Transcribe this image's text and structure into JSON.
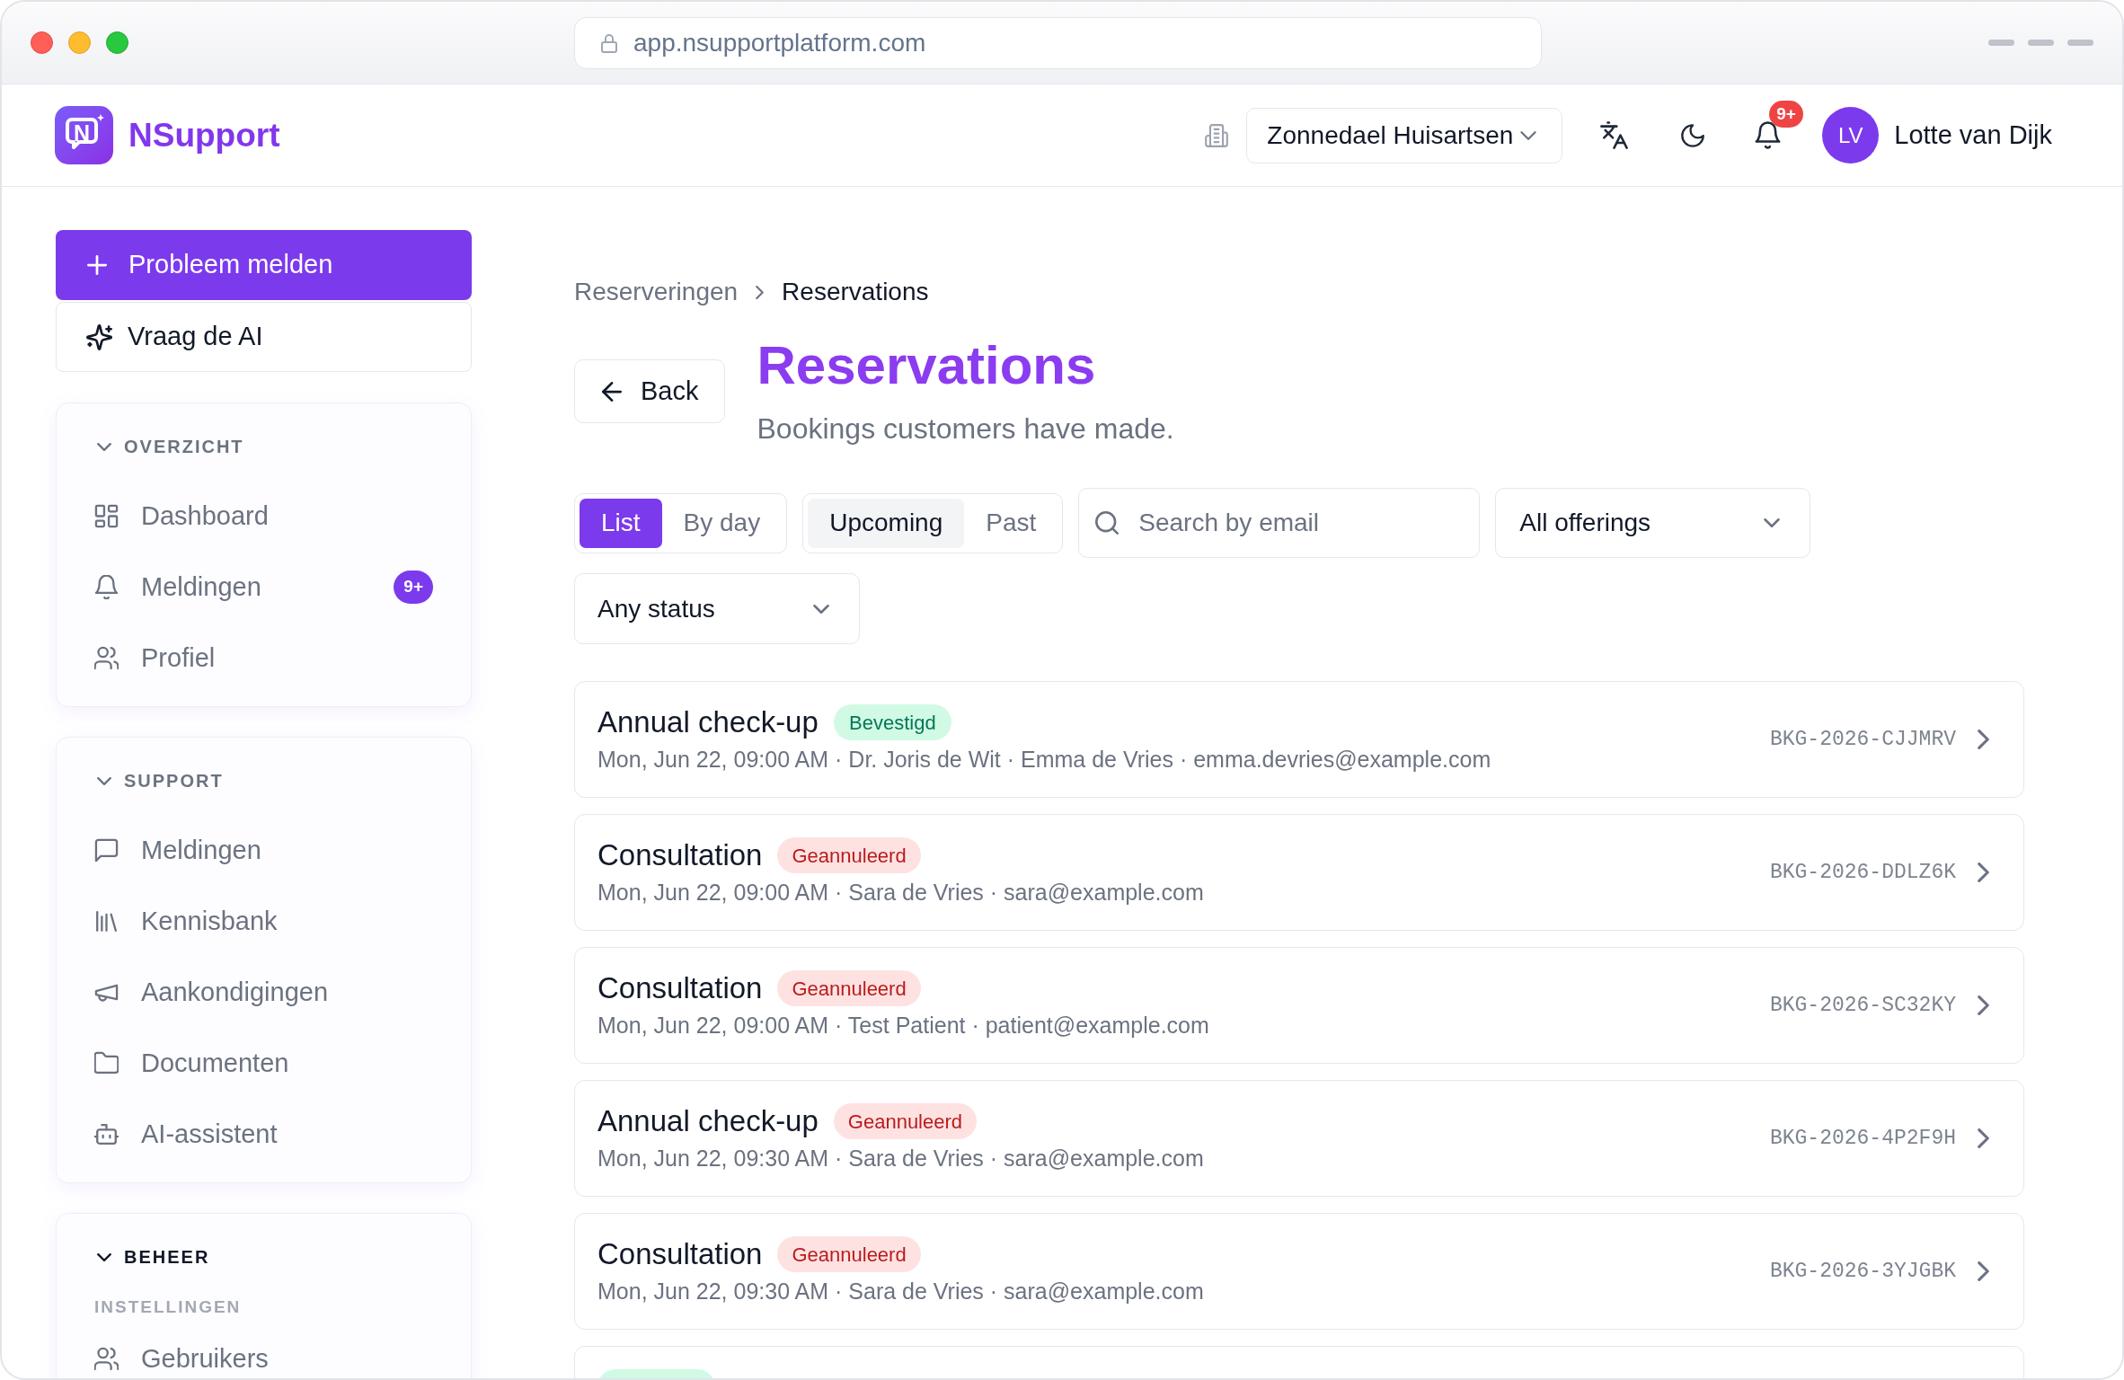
{
  "browser": {
    "url": "app.nsupportplatform.com"
  },
  "header": {
    "brand": {
      "logo_letter": "N",
      "name": "NSupport"
    },
    "organization_select": {
      "value": "Zonnedael Huisartsen"
    },
    "notifications": {
      "badge": "9+"
    },
    "user": {
      "initials": "LV",
      "name": "Lotte van Dijk"
    }
  },
  "sidebar": {
    "actions": [
      {
        "label": "Probleem melden",
        "kind": "primary"
      },
      {
        "label": "Vraag de AI",
        "kind": "secondary"
      }
    ],
    "groups": [
      {
        "title": "OVERZICHT",
        "expanded": true,
        "active": false,
        "items": [
          {
            "kind": "link",
            "label": "Dashboard"
          },
          {
            "kind": "link",
            "label": "Meldingen",
            "badge": "9+"
          },
          {
            "kind": "link",
            "label": "Profiel"
          }
        ]
      },
      {
        "title": "SUPPORT",
        "expanded": true,
        "active": false,
        "items": [
          {
            "kind": "link",
            "label": "Meldingen"
          },
          {
            "kind": "link",
            "label": "Kennisbank"
          },
          {
            "kind": "link",
            "label": "Aankondigingen"
          },
          {
            "kind": "link",
            "label": "Documenten"
          },
          {
            "kind": "link",
            "label": "AI-assistent"
          }
        ]
      },
      {
        "title": "BEHEER",
        "expanded": true,
        "active": true,
        "items": [
          {
            "kind": "heading",
            "label": "INSTELLINGEN"
          },
          {
            "kind": "link",
            "label": "Gebruikers"
          }
        ]
      }
    ]
  },
  "page": {
    "breadcrumb": [
      {
        "label": "Reserveringen",
        "current": false
      },
      {
        "label": "Reservations",
        "current": true
      }
    ],
    "back_button": "Back",
    "title": "Reservations",
    "subtitle": "Bookings customers have made.",
    "filters": {
      "view_toggle": [
        {
          "label": "List",
          "selected": true
        },
        {
          "label": "By day",
          "selected": false
        }
      ],
      "time_toggle": [
        {
          "label": "Upcoming",
          "selected": true
        },
        {
          "label": "Past",
          "selected": false
        }
      ],
      "search": {
        "placeholder": "Search by email"
      },
      "offering_select": {
        "value": "All offerings"
      },
      "status_select": {
        "value": "Any status"
      }
    },
    "reservations": [
      {
        "title": "Annual check-up",
        "status": {
          "label": "Bevestigd",
          "kind": "confirmed"
        },
        "details": "Mon, Jun 22, 09:00 AM · Dr. Joris de Wit · Emma de Vries · emma.devries@example.com",
        "code": "BKG-2026-CJJMRV"
      },
      {
        "title": "Consultation",
        "status": {
          "label": "Geannuleerd",
          "kind": "cancelled"
        },
        "details": "Mon, Jun 22, 09:00 AM · Sara de Vries · sara@example.com",
        "code": "BKG-2026-DDLZ6K"
      },
      {
        "title": "Consultation",
        "status": {
          "label": "Geannuleerd",
          "kind": "cancelled"
        },
        "details": "Mon, Jun 22, 09:00 AM · Test Patient · patient@example.com",
        "code": "BKG-2026-SC32KY"
      },
      {
        "title": "Annual check-up",
        "status": {
          "label": "Geannuleerd",
          "kind": "cancelled"
        },
        "details": "Mon, Jun 22, 09:30 AM · Sara de Vries · sara@example.com",
        "code": "BKG-2026-4P2F9H"
      },
      {
        "title": "Consultation",
        "status": {
          "label": "Geannuleerd",
          "kind": "cancelled"
        },
        "details": "Mon, Jun 22, 09:30 AM · Sara de Vries · sara@example.com",
        "code": "BKG-2026-3YJGBK"
      },
      {
        "status": {
          "kind": "confirmed"
        }
      }
    ]
  }
}
